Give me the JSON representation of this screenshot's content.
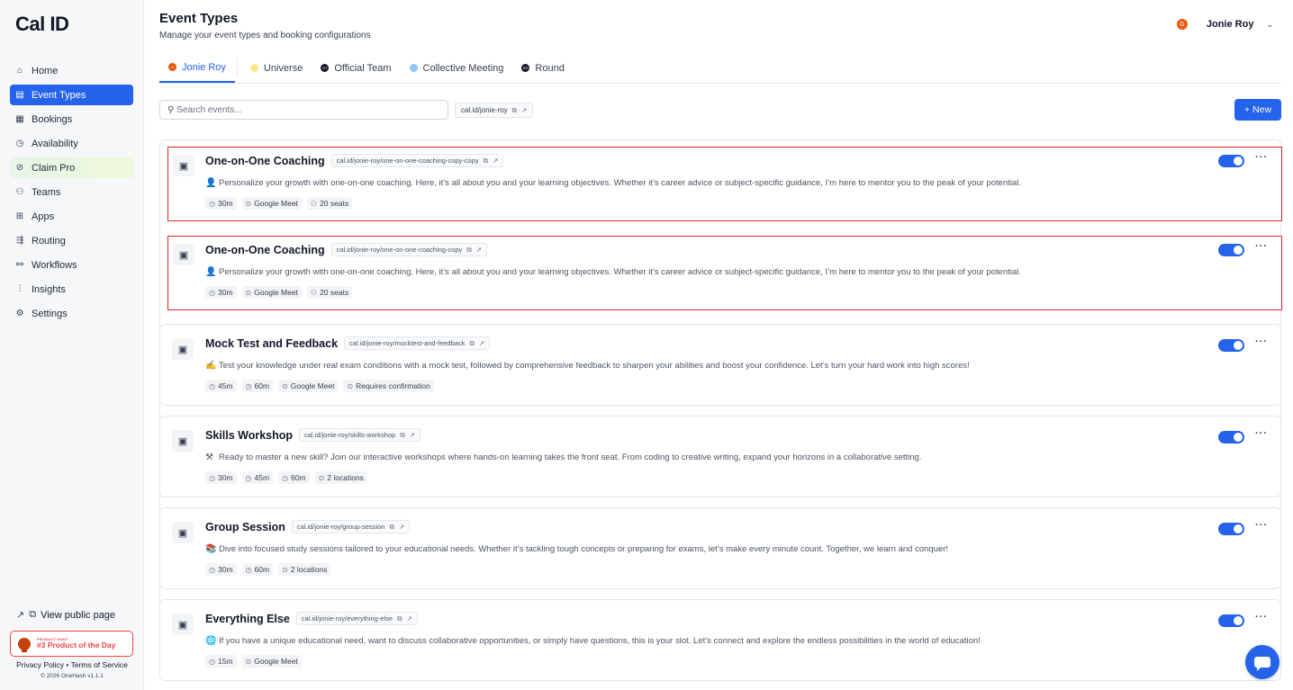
{
  "app": {
    "logo": "Cal ID"
  },
  "sidebar": {
    "items": [
      {
        "label": "Home",
        "icon": "⌂"
      },
      {
        "label": "Event Types",
        "icon": "▤"
      },
      {
        "label": "Bookings",
        "icon": "▦"
      },
      {
        "label": "Availability",
        "icon": "◷"
      },
      {
        "label": "Claim Pro",
        "icon": "⊘"
      },
      {
        "label": "Teams",
        "icon": "⚇"
      },
      {
        "label": "Apps",
        "icon": "⊞"
      },
      {
        "label": "Routing",
        "icon": "⇶"
      },
      {
        "label": "Workflows",
        "icon": "⚯"
      },
      {
        "label": "Insights",
        "icon": "⫶"
      },
      {
        "label": "Settings",
        "icon": "⚙"
      }
    ],
    "active_index": 1,
    "view_public_page": "View public page",
    "product_hunt": {
      "small": "PRODUCT HUNT",
      "big": "#3 Product of the Day"
    },
    "footer_links": "Privacy Policy • Terms of Service",
    "copyright": "© 2026 OneHash v1.1.1"
  },
  "header": {
    "title": "Event Types",
    "subtitle": "Manage your event types and booking configurations",
    "user_initial": "G",
    "user_name": "Jonie Roy"
  },
  "tabs": [
    {
      "label": "Jonie Roy",
      "icon_text": "G",
      "icon_color": "#ea580c",
      "active": true
    },
    {
      "label": "Universe",
      "icon_text": "",
      "icon_color": "#fde68a",
      "active": false
    },
    {
      "label": "Official Team",
      "icon_text": "OT",
      "icon_color": "#111827",
      "active": false
    },
    {
      "label": "Collective Meeting",
      "icon_text": "",
      "icon_color": "#93c5fd",
      "active": false
    },
    {
      "label": "Round",
      "icon_text": "RO",
      "icon_color": "#111827",
      "active": false
    }
  ],
  "toolbar": {
    "search_placeholder": "Search events...",
    "public_link": "cal.id/jonie-roy",
    "new_label": "+ New"
  },
  "events": [
    {
      "title": "One-on-One Coaching",
      "slug": "cal.id/jonie-roy/one-on-one-coaching-copy-copy",
      "emoji": "👤",
      "description": "Personalize your growth with one-on-one coaching. Here, it’s all about you and your learning objectives. Whether it’s career advice or subject-specific guidance, I’m here to mentor you to the peak of your potential.",
      "tags": [
        {
          "icon": "◷",
          "text": "30m"
        },
        {
          "icon": "⊙",
          "text": "Google Meet"
        },
        {
          "icon": "⚇",
          "text": "20 seats"
        }
      ],
      "enabled": true,
      "selected": true
    },
    {
      "title": "One-on-One Coaching",
      "slug": "cal.id/jonie-roy/one-on-one-coaching-copy",
      "emoji": "👤",
      "description": "Personalize your growth with one-on-one coaching. Here, it’s all about you and your learning objectives. Whether it’s career advice or subject-specific guidance, I’m here to mentor you to the peak of your potential.",
      "tags": [
        {
          "icon": "◷",
          "text": "30m"
        },
        {
          "icon": "⊙",
          "text": "Google Meet"
        },
        {
          "icon": "⚇",
          "text": "20 seats"
        }
      ],
      "enabled": true,
      "selected": true
    },
    {
      "title": "Mock Test and Feedback",
      "slug": "cal.id/jonie-roy/mocktest-and-feedback",
      "emoji": "✍",
      "description": "Test your knowledge under real exam conditions with a mock test, followed by comprehensive feedback to sharpen your abilities and boost your confidence. Let’s turn your hard work into high scores!",
      "tags": [
        {
          "icon": "◷",
          "text": "45m"
        },
        {
          "icon": "◷",
          "text": "60m"
        },
        {
          "icon": "⊙",
          "text": "Google Meet"
        },
        {
          "icon": "⊙",
          "text": "Requires confirmation"
        }
      ],
      "enabled": true,
      "selected": false
    },
    {
      "title": "Skills Workshop",
      "slug": "cal.id/jonie-roy/skills-workshop",
      "emoji": "⚒",
      "description": "Ready to master a new skill? Join our interactive workshops where hands-on learning takes the front seat. From coding to creative writing, expand your horizons in a collaborative setting.",
      "tags": [
        {
          "icon": "◷",
          "text": "30m"
        },
        {
          "icon": "◷",
          "text": "45m"
        },
        {
          "icon": "◷",
          "text": "60m"
        },
        {
          "icon": "⊙",
          "text": "2 locations"
        }
      ],
      "enabled": true,
      "selected": false
    },
    {
      "title": "Group Session",
      "slug": "cal.id/jonie-roy/group-session",
      "emoji": "📚",
      "description": "Dive into focused study sessions tailored to your educational needs. Whether it’s tackling tough concepts or preparing for exams, let’s make every minute count. Together, we learn and conquer!",
      "tags": [
        {
          "icon": "◷",
          "text": "30m"
        },
        {
          "icon": "◷",
          "text": "60m"
        },
        {
          "icon": "⊙",
          "text": "2 locations"
        }
      ],
      "enabled": true,
      "selected": false
    },
    {
      "title": "Everything Else",
      "slug": "cal.id/jonie-roy/everything-else",
      "emoji": "🌐",
      "description": "If you have a unique educational need, want to discuss collaborative opportunities, or simply have questions, this is your slot. Let’s connect and explore the endless possibilities in the world of education!",
      "tags": [
        {
          "icon": "◷",
          "text": "15m"
        },
        {
          "icon": "⊙",
          "text": "Google Meet"
        }
      ],
      "enabled": true,
      "selected": false
    }
  ],
  "colors": {
    "accent": "#2563eb",
    "selection_border": "#dc2626",
    "avatar": "#ea580c"
  }
}
